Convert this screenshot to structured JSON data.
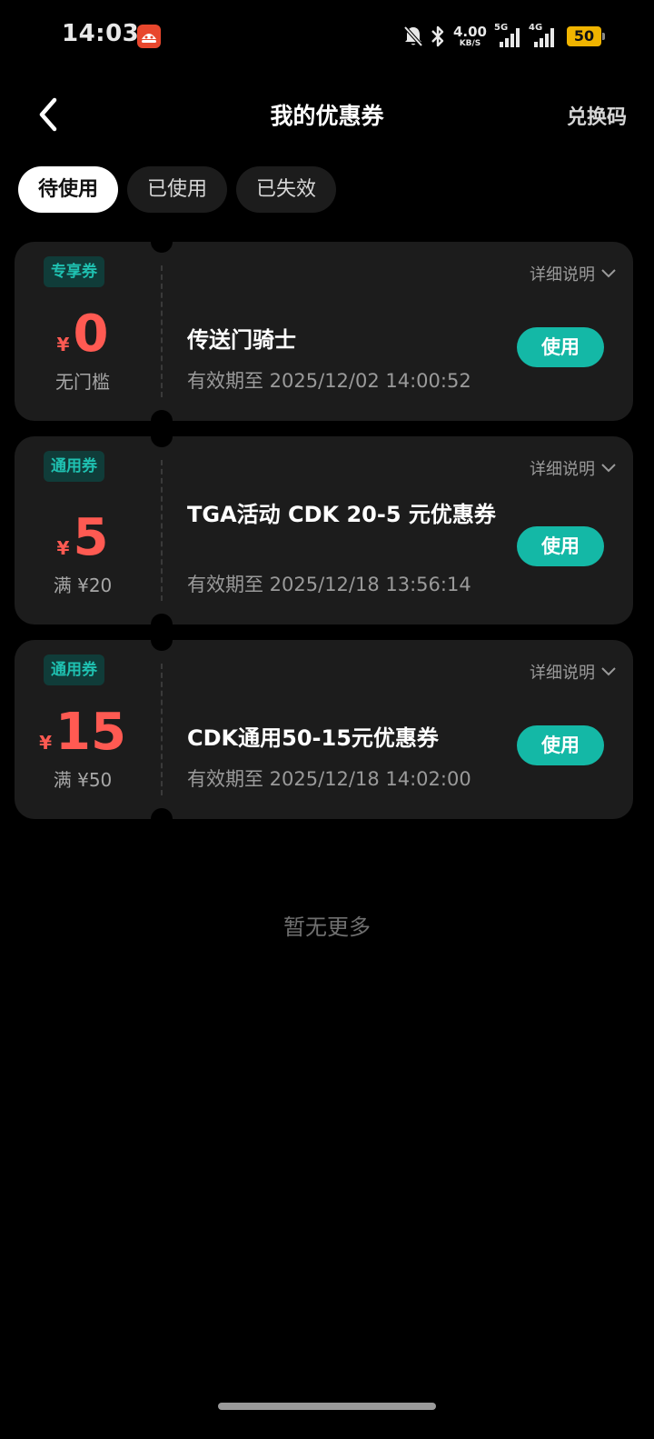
{
  "status_bar": {
    "time": "14:03",
    "net_speed_value": "4.00",
    "net_speed_unit": "KB/S",
    "signal1_tag": "5G",
    "signal2_tag": "4G",
    "battery": "50",
    "icons": [
      "app-notification-icon",
      "bell-off-icon",
      "bluetooth-icon",
      "signal-icon",
      "battery-icon"
    ]
  },
  "header": {
    "title": "我的优惠券",
    "redeem_label": "兑换码",
    "back_icon": "chevron-left-icon"
  },
  "tabs": [
    {
      "label": "待使用",
      "active": true
    },
    {
      "label": "已使用",
      "active": false
    },
    {
      "label": "已失效",
      "active": false
    }
  ],
  "coupons": [
    {
      "tag": "专享券",
      "currency": "¥",
      "amount": "0",
      "threshold": "无门槛",
      "detail_label": "详细说明",
      "name": "传送门骑士",
      "expiry": "有效期至 2025/12/02 14:00:52",
      "button": "使用"
    },
    {
      "tag": "通用券",
      "currency": "¥",
      "amount": "5",
      "threshold": "满 ¥20",
      "detail_label": "详细说明",
      "name": "TGA活动 CDK 20-5 元优惠券",
      "expiry": "有效期至 2025/12/18 13:56:14",
      "button": "使用"
    },
    {
      "tag": "通用券",
      "currency": "¥",
      "amount": "15",
      "threshold": "满 ¥50",
      "detail_label": "详细说明",
      "name": "CDK通用50-15元优惠券",
      "expiry": "有效期至 2025/12/18 14:02:00",
      "button": "使用"
    }
  ],
  "footer_text": "暂无更多",
  "colors": {
    "background": "#000000",
    "card": "#1c1c1c",
    "accent_teal": "#14b8a6",
    "tag_text": "#1fc1b1",
    "amount_red": "#ff5a52",
    "battery_yellow": "#f0b400"
  }
}
